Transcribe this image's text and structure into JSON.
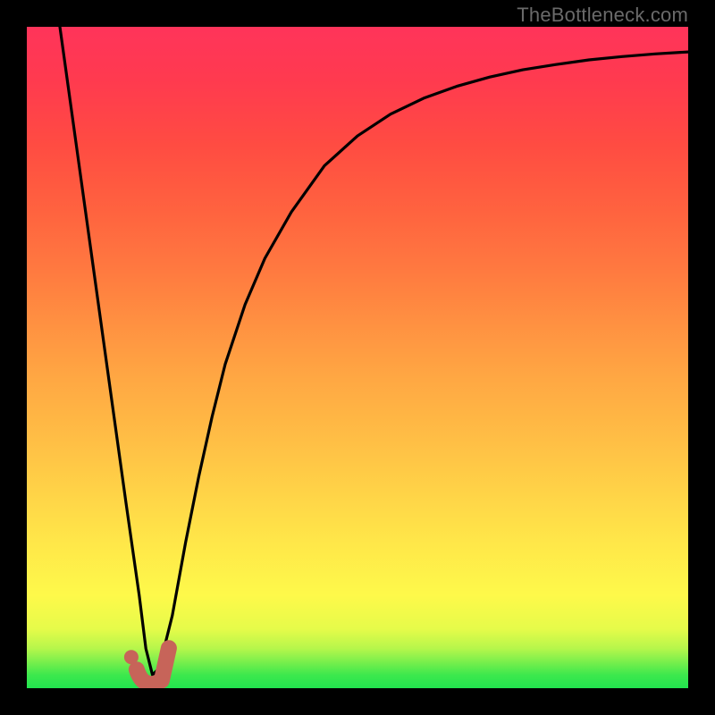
{
  "watermark": "TheBottleneck.com",
  "colors": {
    "frame": "#000000",
    "curve": "#000000",
    "marker_fill": "#c76459",
    "marker_dot": "#c76459"
  },
  "chart_data": {
    "type": "line",
    "title": "",
    "xlabel": "",
    "ylabel": "",
    "xlim": [
      0,
      100
    ],
    "ylim": [
      0,
      100
    ],
    "grid": false,
    "series": [
      {
        "name": "bottleneck-curve",
        "x": [
          5,
          7.5,
          10,
          12.5,
          15,
          17,
          18,
          19,
          20,
          22,
          24,
          26,
          28,
          30,
          33,
          36,
          40,
          45,
          50,
          55,
          60,
          65,
          70,
          75,
          80,
          85,
          90,
          95,
          100
        ],
        "values": [
          100,
          82,
          64,
          46,
          28,
          14,
          6,
          2,
          3,
          11,
          22,
          32,
          41,
          49,
          58,
          65,
          72,
          79,
          83.5,
          86.8,
          89.2,
          91,
          92.4,
          93.5,
          94.3,
          95,
          95.5,
          95.9,
          96.2
        ]
      }
    ],
    "marker": {
      "x": 18.5,
      "y": 2,
      "shape": "J-hook"
    },
    "annotations": []
  }
}
